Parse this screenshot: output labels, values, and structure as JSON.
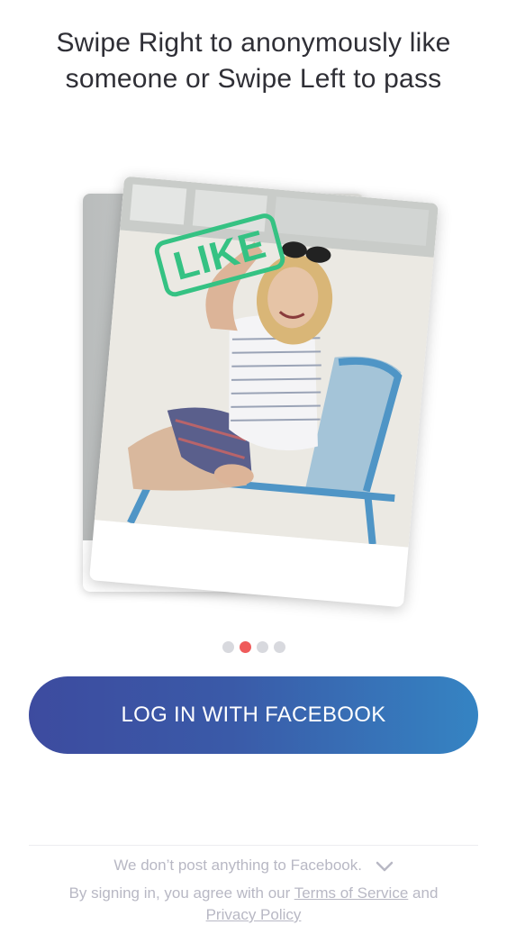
{
  "onboarding": {
    "headline": "Swipe Right to anonymously like someone or Swipe Left to pass",
    "stamp_label": "LIKE",
    "page_indicator": {
      "total": 4,
      "current": 2
    },
    "colors": {
      "like_green": "#35c283",
      "dot_active": "#ef5b5b",
      "dot_inactive": "#d8d9de",
      "button_gradient_start": "#3d4b9f",
      "button_gradient_end": "#3584c3"
    }
  },
  "login": {
    "facebook_button_label": "LOG IN WITH FACEBOOK"
  },
  "footer": {
    "disclaimer": "We don’t post anything to Facebook.",
    "legal_prefix": "By signing in, you agree with our",
    "terms_link": "Terms of Service",
    "legal_joiner": "and",
    "privacy_link": "Privacy Policy"
  }
}
